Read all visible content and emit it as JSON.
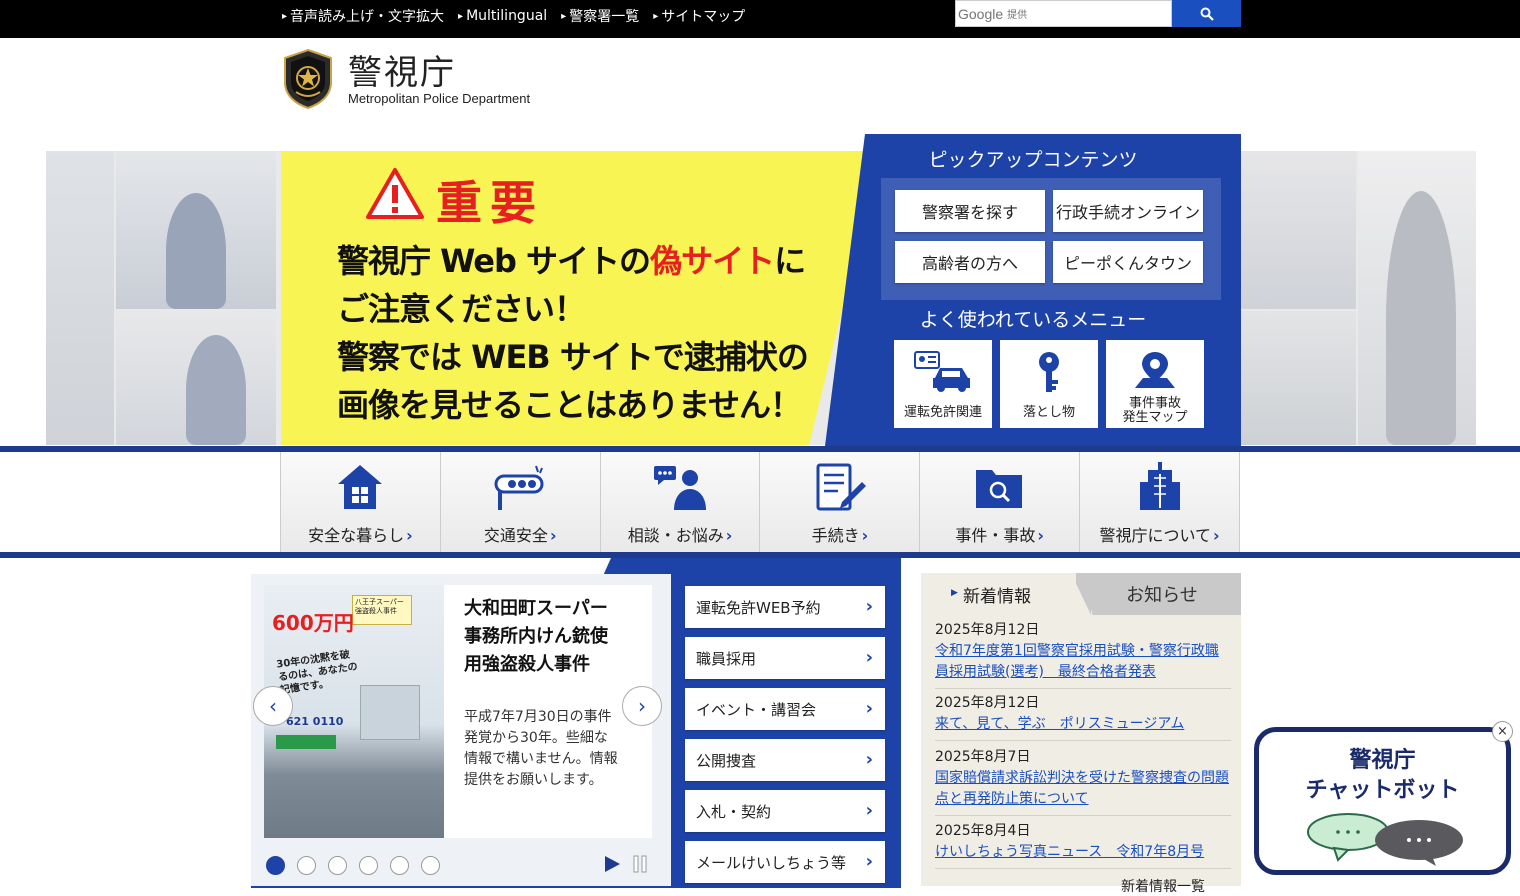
{
  "topnav": {
    "items": [
      "音声読み上げ・文字拡大",
      "Multilingual",
      "警察署一覧",
      "サイトマップ"
    ],
    "arrow": "▸"
  },
  "search": {
    "brand": "Google",
    "provided": "提供",
    "button_icon": "search-icon"
  },
  "header": {
    "title_jp": "警視庁",
    "title_en": "Metropolitan Police Department"
  },
  "banner": {
    "heading": "重要",
    "line1_a": "警視庁 Web サイトの",
    "line1_red": "偽サイト",
    "line1_b": "に",
    "line2": "ご注意ください！",
    "line3": "警察では WEB サイトで逮捕状の",
    "line4": "画像を見せることはありません！"
  },
  "pickup": {
    "title": "ピックアップコンテンツ",
    "buttons": [
      "警察署を探す",
      "行政手続オンライン",
      "高齢者の方へ",
      "ピーポくんタウン"
    ],
    "menu_title": "よく使われているメニュー",
    "menu": [
      {
        "label": "運転免許関連",
        "icon": "car-license-icon"
      },
      {
        "label": "落とし物",
        "icon": "key-icon"
      },
      {
        "label": "事件事故\n発生マップ",
        "icon": "map-pin-icon"
      }
    ]
  },
  "categories": [
    {
      "label": "安全な暮らし",
      "icon": "house-icon"
    },
    {
      "label": "交通安全",
      "icon": "traffic-light-icon"
    },
    {
      "label": "相談・お悩み",
      "icon": "consultation-icon"
    },
    {
      "label": "手続き",
      "icon": "document-pen-icon"
    },
    {
      "label": "事件・事故",
      "icon": "folder-search-icon"
    },
    {
      "label": "警視庁について",
      "icon": "building-icon"
    }
  ],
  "category_chevron": "›",
  "slide": {
    "title": "大和田町スーパー事務所内けん銃使用強盗殺人事件",
    "desc": "平成7年7月30日の事件発覚から30年。些細な情報で構いません。情報提供をお願いします。",
    "poster": {
      "head_text": "八王子スーパー強盗殺人事件",
      "reward": "600万円",
      "slogan": "30年の沈黙を破るのは、あなたの記憶です。",
      "phone": "621 0110"
    },
    "prev": "‹",
    "next": "›"
  },
  "slider_dots": 6,
  "quick_links": [
    "運転免許WEB予約",
    "職員採用",
    "イベント・講習会",
    "公開捜査",
    "入札・契約",
    "メールけいしちょう等"
  ],
  "news": {
    "tab_active": "新着情報",
    "tab_inactive": "お知らせ",
    "items": [
      {
        "date": "2025年8月12日",
        "text": "令和7年度第1回警察官採用試験・警察行政職員採用試験(選考)　最終合格者発表"
      },
      {
        "date": "2025年8月12日",
        "text": "来て、見て、学ぶ　ポリスミュージアム"
      },
      {
        "date": "2025年8月7日",
        "text": "国家賠償請求訴訟判決を受けた警察捜査の問題点と再発防止策について"
      },
      {
        "date": "2025年8月4日",
        "text": "けいしちょう写真ニュース　令和7年8月号"
      }
    ],
    "more": "新着情報一覧"
  },
  "chatbot": {
    "line1": "警視庁",
    "line2": "チャットボット",
    "close": "×"
  },
  "colors": {
    "brand_blue": "#1d43a8",
    "banner_yellow": "#f8f453",
    "alert_red": "#e62020"
  }
}
